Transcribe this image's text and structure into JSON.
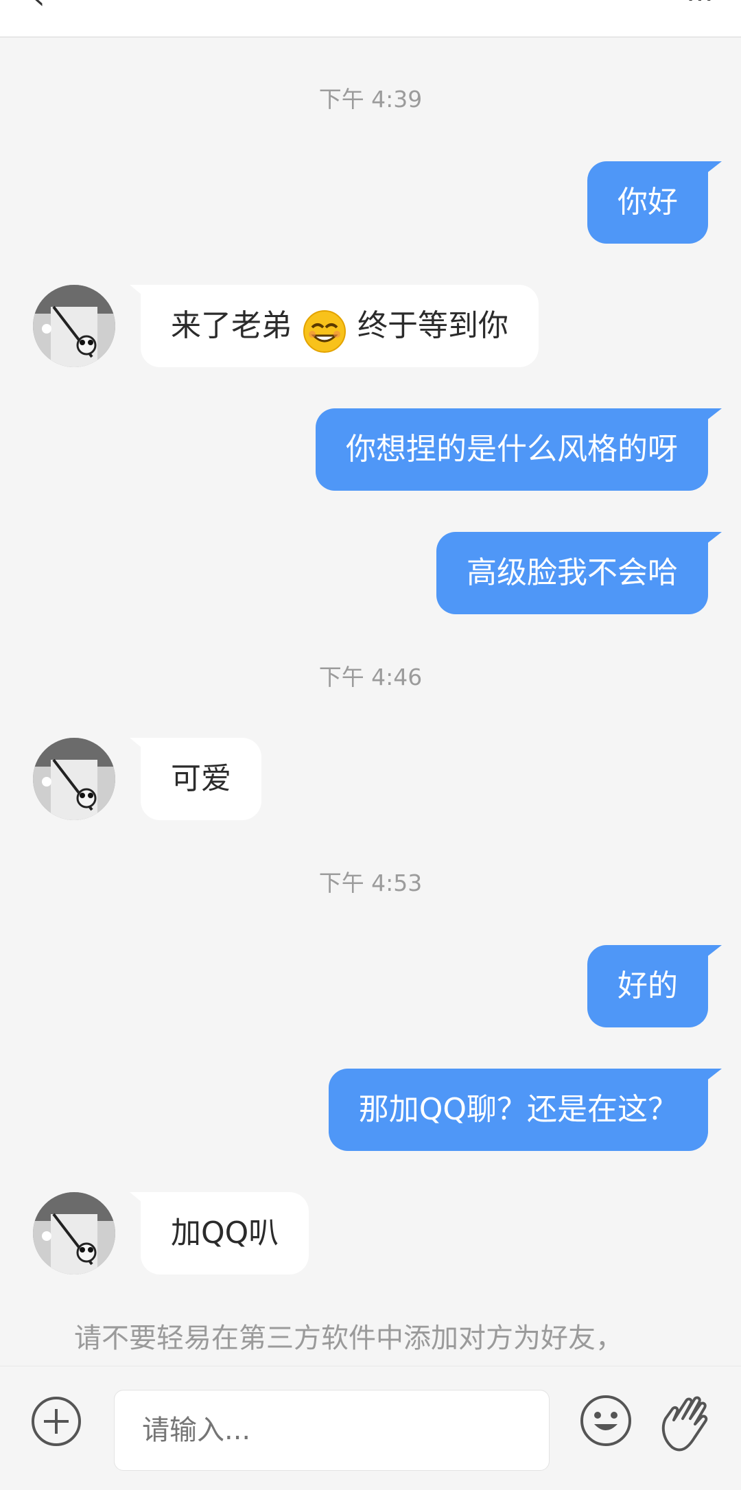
{
  "header": {
    "back_icon": "back-icon",
    "title": "",
    "more_icon": "more-icon"
  },
  "messages": [
    {
      "type": "time",
      "text": "下午 4:39"
    },
    {
      "type": "out",
      "text": "你好"
    },
    {
      "type": "in",
      "text_before": "来了老弟",
      "emoji": "grinning-face-icon",
      "text_after": "终于等到你"
    },
    {
      "type": "out",
      "text": "你想捏的是什么风格的呀"
    },
    {
      "type": "out",
      "text": "高级脸我不会哈"
    },
    {
      "type": "time",
      "text": "下午 4:46"
    },
    {
      "type": "in",
      "text": "可爱"
    },
    {
      "type": "time",
      "text": "下午 4:53"
    },
    {
      "type": "out",
      "text": "好的"
    },
    {
      "type": "out",
      "text": "那加QQ聊？还是在这？"
    },
    {
      "type": "in",
      "text": "加QQ叭"
    }
  ],
  "notice": {
    "line1": "请不要轻易在第三方软件中添加对方为好友，"
  },
  "inputbar": {
    "placeholder": "请输入...",
    "plus_icon": "plus-icon",
    "emoji_icon": "smiley-icon",
    "wave_icon": "hand-wave-icon"
  },
  "colors": {
    "outgoing_bubble": "#4f97f7",
    "incoming_bubble": "#ffffff",
    "background": "#f5f5f5"
  }
}
